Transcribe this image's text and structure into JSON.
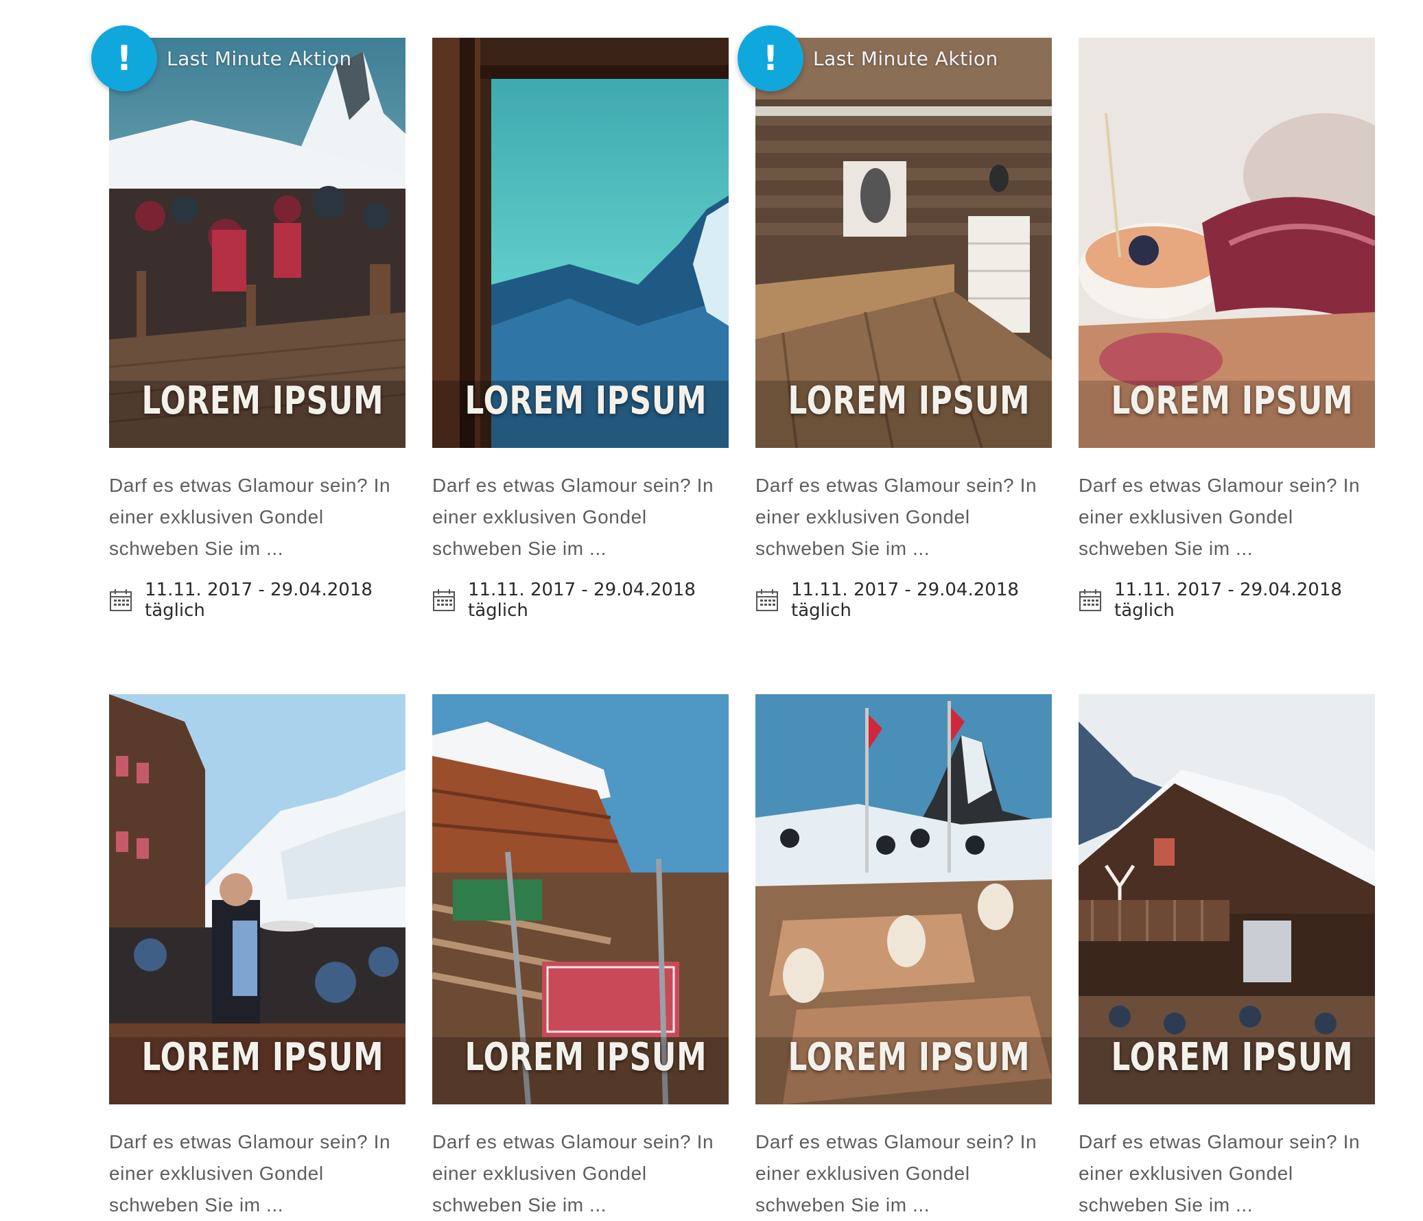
{
  "cards": [
    {
      "title": "LOREM IPSUM",
      "promo": "Last Minute Aktion",
      "badge": "!",
      "teaser": "Darf es etwas Glamour sein? In einer exklusiven Gondel schweben Sie im ...",
      "date": "11.11. 2017 - 29.04.2018 täglich"
    },
    {
      "title": "LOREM IPSUM",
      "teaser": "Darf es etwas Glamour sein? In einer exklusiven Gondel schweben Sie im ...",
      "date": "11.11. 2017 - 29.04.2018 täglich"
    },
    {
      "title": "LOREM IPSUM",
      "promo": "Last Minute Aktion",
      "badge": "!",
      "teaser": "Darf es etwas Glamour sein? In einer exklusiven Gondel schweben Sie im ...",
      "date": "11.11. 2017 - 29.04.2018 täglich"
    },
    {
      "title": "LOREM IPSUM",
      "teaser": "Darf es etwas Glamour sein? In einer exklusiven Gondel schweben Sie im ...",
      "date": "11.11. 2017 - 29.04.2018 täglich"
    },
    {
      "title": "LOREM IPSUM",
      "teaser": "Darf es etwas Glamour sein? In einer exklusiven Gondel schweben Sie im ..."
    },
    {
      "title": "LOREM IPSUM",
      "teaser": "Darf es etwas Glamour sein? In einer exklusiven Gondel schweben Sie im ..."
    },
    {
      "title": "LOREM IPSUM",
      "teaser": "Darf es etwas Glamour sein? In einer exklusiven Gondel schweben Sie im ..."
    },
    {
      "title": "LOREM IPSUM",
      "teaser": "Darf es etwas Glamour sein? In einer exklusiven Gondel schweben Sie im ..."
    }
  ],
  "icons": {
    "date": "calendar-icon",
    "badge": "exclamation-icon"
  },
  "colors": {
    "badge": "#10a7dd",
    "teaser_text": "#5d5d5d",
    "date_text": "#2a2a2a"
  }
}
